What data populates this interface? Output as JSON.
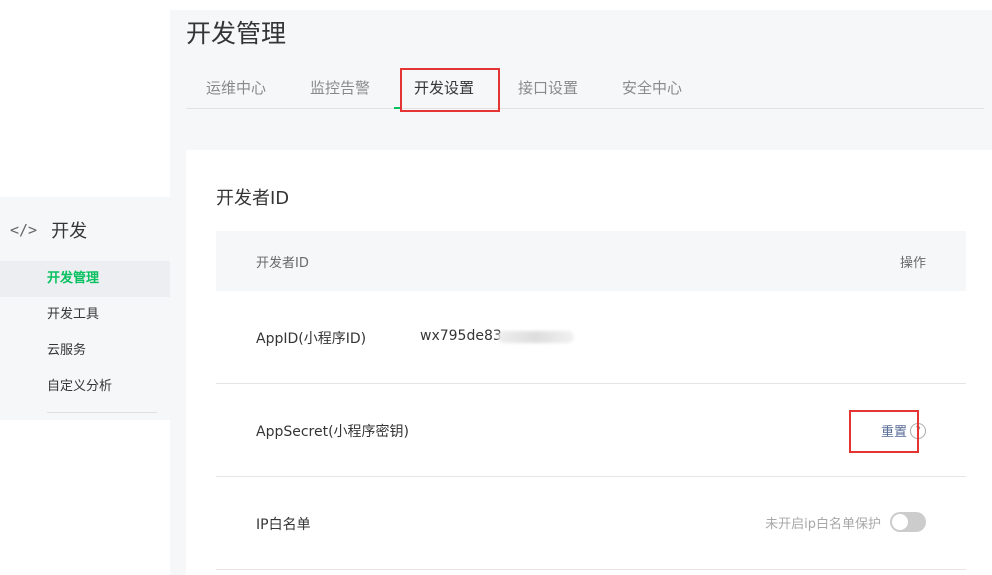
{
  "sidebar": {
    "section": "开发",
    "section_icon": "</>",
    "items": [
      {
        "label": "开发管理",
        "active": true
      },
      {
        "label": "开发工具"
      },
      {
        "label": "云服务"
      },
      {
        "label": "自定义分析"
      }
    ]
  },
  "page_title": "开发管理",
  "tabs": [
    {
      "label": "运维中心"
    },
    {
      "label": "监控告警"
    },
    {
      "label": "开发设置",
      "active": true
    },
    {
      "label": "接口设置"
    },
    {
      "label": "安全中心"
    }
  ],
  "card": {
    "title": "开发者ID",
    "header": {
      "col1": "开发者ID",
      "col2": "操作"
    },
    "rows": {
      "appid": {
        "label": "AppID(小程序ID)",
        "value": "wx795de83"
      },
      "secret": {
        "label": "AppSecret(小程序密钥)",
        "action": "重置",
        "help": "?"
      },
      "ip": {
        "label": "IP白名单",
        "status": "未开启ip白名单保护",
        "enabled": false
      }
    }
  },
  "colors": {
    "accent": "#07c160",
    "link": "#576b95",
    "highlight": "#e53434"
  }
}
